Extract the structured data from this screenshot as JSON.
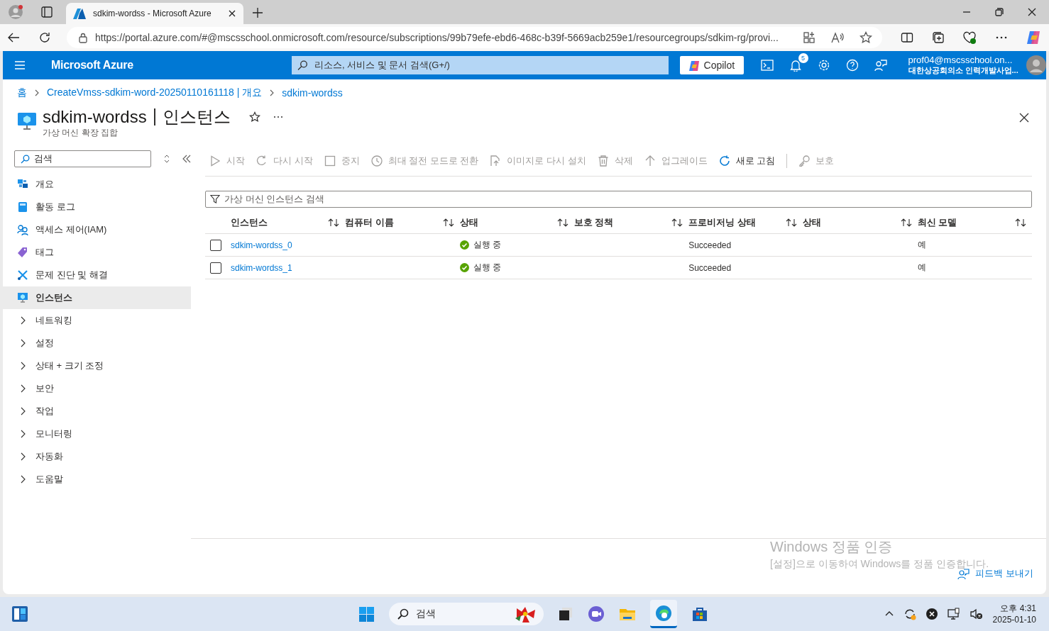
{
  "browser": {
    "tab": {
      "title": "sdkim-wordss - Microsoft Azure",
      "selected": true
    },
    "url": "https://portal.azure.com/#@mscsschool.onmicrosoft.com/resource/subscriptions/99b79efe-ebd6-468c-b39f-5669acb259e1/resourcegroups/sdkim-rg/provi..."
  },
  "topbar": {
    "brand": "Microsoft Azure",
    "search_placeholder": "리소스, 서비스 및 문서 검색(G+/)",
    "copilot": "Copilot",
    "notification_count": "5",
    "account": {
      "email": "prof04@mscsschool.on...",
      "org": "대한상공회의소 인력개발사업..."
    }
  },
  "breadcrumb": [
    "홈",
    "CreateVmss-sdkim-word-20250110161118 | 개요",
    "sdkim-wordss"
  ],
  "page": {
    "title": "sdkim-wordss",
    "section": "인스턴스",
    "subtitle": "가상 머신 확장 집합"
  },
  "sidebar": {
    "search_placeholder": "검색",
    "items": [
      {
        "label": "개요",
        "kind": "overview",
        "selected": false
      },
      {
        "label": "활동 로그",
        "kind": "log",
        "selected": false
      },
      {
        "label": "액세스 제어(IAM)",
        "kind": "iam",
        "selected": false
      },
      {
        "label": "태그",
        "kind": "tag",
        "selected": false
      },
      {
        "label": "문제 진단 및 해결",
        "kind": "tools",
        "selected": false
      },
      {
        "label": "인스턴스",
        "kind": "vm",
        "selected": true
      },
      {
        "label": "네트워킹",
        "kind": "group",
        "selected": false
      },
      {
        "label": "설정",
        "kind": "group",
        "selected": false
      },
      {
        "label": "상태 + 크기 조정",
        "kind": "group",
        "selected": false
      },
      {
        "label": "보안",
        "kind": "group",
        "selected": false
      },
      {
        "label": "작업",
        "kind": "group",
        "selected": false
      },
      {
        "label": "모니터링",
        "kind": "group",
        "selected": false
      },
      {
        "label": "자동화",
        "kind": "group",
        "selected": false
      },
      {
        "label": "도움말",
        "kind": "group",
        "selected": false
      }
    ]
  },
  "toolbar": [
    {
      "label": "시작",
      "kind": "play",
      "disabled": true
    },
    {
      "label": "다시 시작",
      "kind": "restart",
      "disabled": true
    },
    {
      "label": "중지",
      "kind": "stop",
      "disabled": true
    },
    {
      "label": "최대 절전 모드로 전환",
      "kind": "clock",
      "disabled": true
    },
    {
      "label": "이미지로 다시 설치",
      "kind": "reimage",
      "disabled": true
    },
    {
      "label": "삭제",
      "kind": "trash",
      "disabled": true
    },
    {
      "label": "업그레이드",
      "kind": "upgrade",
      "disabled": true
    },
    {
      "label": "새로 고침",
      "kind": "refresh",
      "disabled": false
    },
    {
      "label": "보호",
      "kind": "key",
      "disabled": true
    }
  ],
  "filter_placeholder": "가상 머신 인스턴스 검색",
  "table": {
    "columns": [
      "인스턴스",
      "컴퓨터 이름",
      "상태",
      "보호 정책",
      "프로비저닝 상태",
      "상태",
      "최신 모델"
    ],
    "rows": [
      {
        "checked": false,
        "kind": "running",
        "cells": [
          "sdkim-wordss_0",
          "",
          "실행 중",
          "",
          "Succeeded",
          "",
          "예"
        ]
      },
      {
        "checked": false,
        "kind": "running",
        "cells": [
          "sdkim-wordss_1",
          "",
          "실행 중",
          "",
          "Succeeded",
          "",
          "예"
        ]
      }
    ]
  },
  "feedback": "피드백 보내기",
  "activation": {
    "title": "Windows 정품 인증",
    "message": "[설정]으로 이동하여 Windows를 정품 인증합니다."
  },
  "taskbar": {
    "search_placeholder": "검색",
    "time": "오후 4:31",
    "date": "2025-01-10"
  }
}
